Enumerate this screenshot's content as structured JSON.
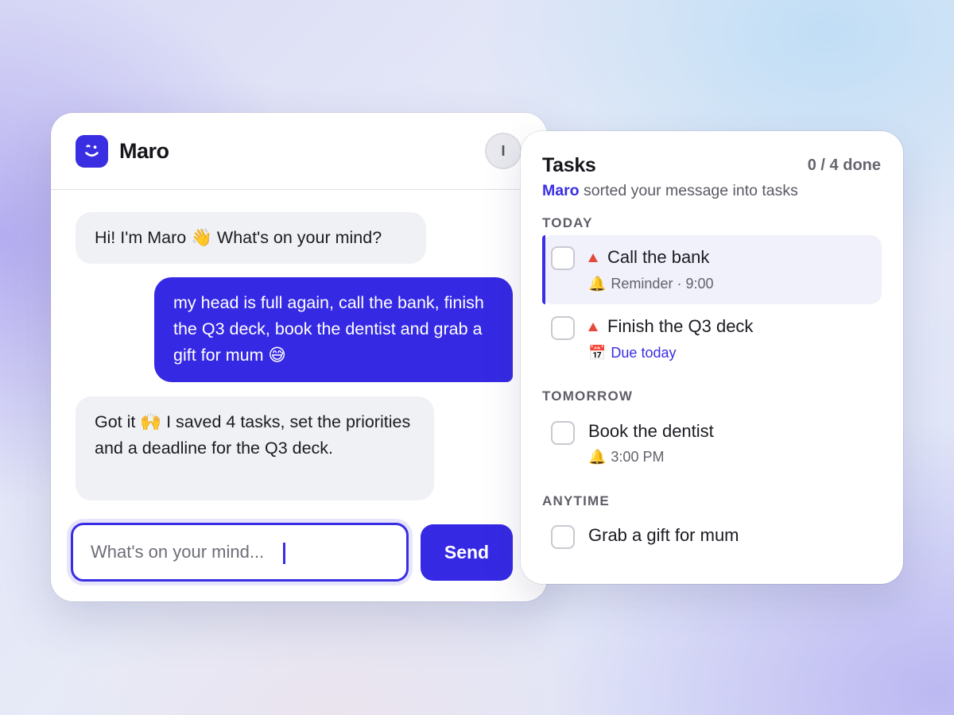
{
  "chat": {
    "app_name": "Maro",
    "avatar_initial": "I",
    "messages": [
      {
        "from": "bot",
        "text": "Hi! I'm Maro 👋 What's on your mind?"
      },
      {
        "from": "user",
        "text": "my head is full again, call the bank, finish the Q3 deck, book the dentist and grab a gift for mum 😅"
      },
      {
        "from": "bot",
        "text": "Got it 🙌 I saved 4 tasks, set the priorities and a deadline for the Q3 deck."
      }
    ],
    "input": {
      "value": "",
      "placeholder": "What's on your mind..."
    },
    "send_label": "Send"
  },
  "tasks": {
    "title": "Tasks",
    "done_count": "0 / 4 done",
    "subtitle_brand": "Maro",
    "subtitle_rest": "sorted your message into tasks",
    "sections": [
      {
        "label": "TODAY",
        "items": [
          {
            "title": "Call the bank",
            "priority": "high",
            "meta_icon": "🔔",
            "meta": "Reminder · 9:00",
            "active": true
          },
          {
            "title": "Finish the Q3 deck",
            "priority": "high",
            "meta_icon": "📅",
            "meta": "Due today",
            "active": false
          }
        ]
      },
      {
        "label": "TOMORROW",
        "items": [
          {
            "title": "Book the dentist",
            "meta_icon": "🔔",
            "meta": "3:00 PM",
            "active": false
          }
        ]
      },
      {
        "label": "ANYTIME",
        "items": [
          {
            "title": "Grab a gift for mum",
            "active": false
          }
        ]
      }
    ]
  },
  "colors": {
    "accent": "#3529e4",
    "priority_high": "#e44a3c"
  }
}
